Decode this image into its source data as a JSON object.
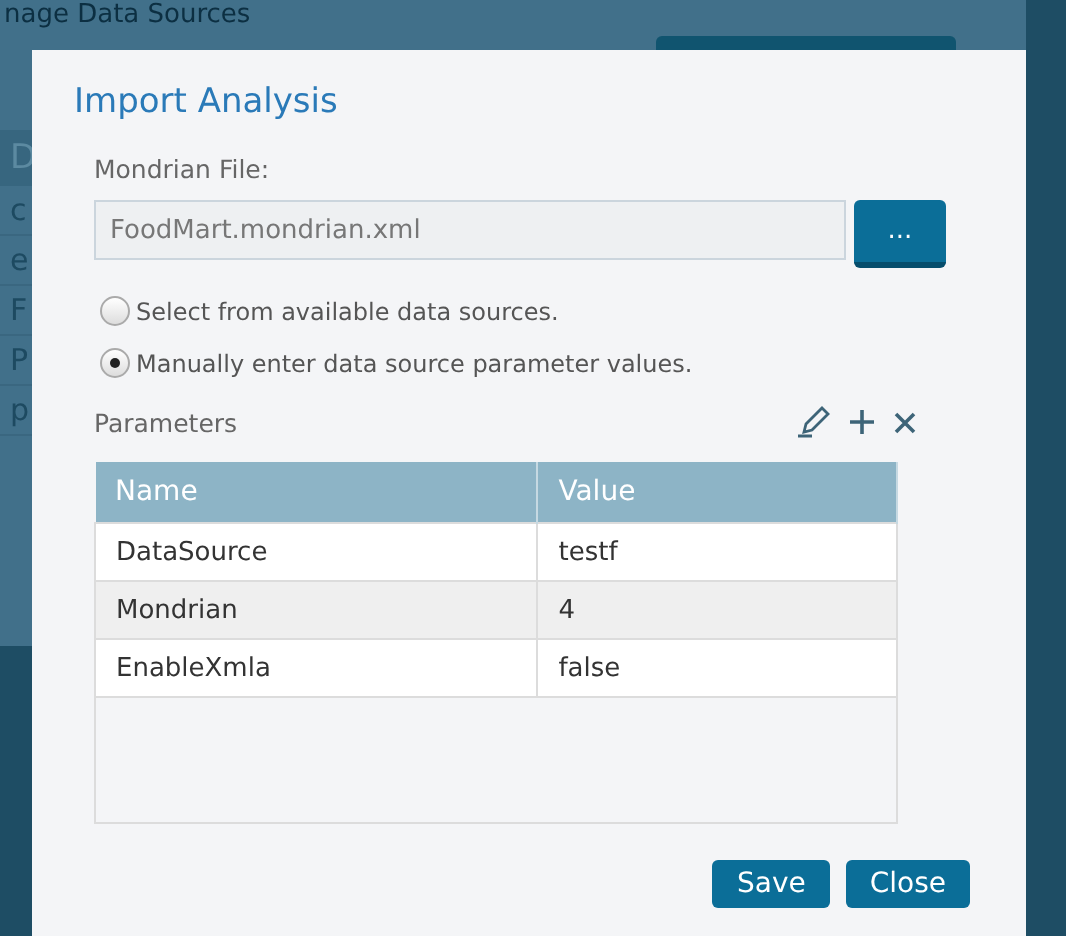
{
  "background": {
    "title": "nage Data Sources",
    "list_header": "D",
    "list_items": [
      "c",
      "e",
      "F",
      "P",
      "p"
    ]
  },
  "dialog": {
    "title": "Import Analysis",
    "file_label": "Mondrian File:",
    "file_field": {
      "value": "FoodMart.mondrian.xml"
    },
    "browse_button": "...",
    "options": [
      {
        "label": "Select from available data sources.",
        "selected": false
      },
      {
        "label": "Manually enter data source parameter values.",
        "selected": true
      }
    ],
    "parameters_label": "Parameters",
    "table": {
      "columns": [
        "Name",
        "Value"
      ],
      "rows": [
        [
          "DataSource",
          "testf"
        ],
        [
          "Mondrian",
          "4"
        ],
        [
          "EnableXmla",
          "false"
        ]
      ]
    },
    "buttons": [
      "Save",
      "Close"
    ]
  }
}
